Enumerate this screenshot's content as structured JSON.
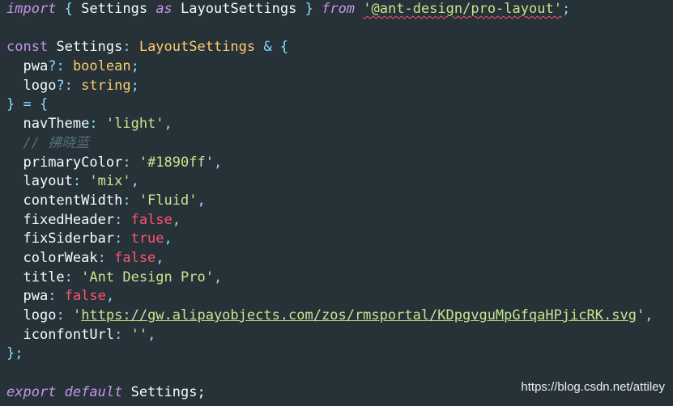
{
  "code": {
    "kw_import": "import",
    "brace_open": "{",
    "brace_close": "}",
    "settings": "Settings",
    "kw_as": "as",
    "layout_settings": "LayoutSettings",
    "kw_from": "from",
    "module_path": "'@ant-design/pro-layout'",
    "semicolon": ";",
    "kw_const": "const",
    "colon": ":",
    "amp": "&",
    "pwa_opt": "pwa",
    "logo_opt": "logo",
    "optional": "?:",
    "type_boolean": "boolean",
    "type_string": "string",
    "type_close_assign": "} = {",
    "comma": ",",
    "props": {
      "navTheme": {
        "key": "navTheme",
        "value": "'light'"
      },
      "comment": "// 拂晓蓝",
      "primaryColor": {
        "key": "primaryColor",
        "value": "'#1890ff'"
      },
      "layout": {
        "key": "layout",
        "value": "'mix'"
      },
      "contentWidth": {
        "key": "contentWidth",
        "value": "'Fluid'"
      },
      "fixedHeader": {
        "key": "fixedHeader",
        "value": "false"
      },
      "fixSiderbar": {
        "key": "fixSiderbar",
        "value": "true"
      },
      "colorWeak": {
        "key": "colorWeak",
        "value": "false"
      },
      "title": {
        "key": "title",
        "value": "'Ant Design Pro'"
      },
      "pwa": {
        "key": "pwa",
        "value": "false"
      },
      "logo": {
        "key": "logo",
        "quote": "'",
        "url": "https://gw.alipayobjects.com/zos/rmsportal/KDpgvguMpGfqaHPjicRK.svg"
      },
      "iconfontUrl": {
        "key": "iconfontUrl",
        "value": "''"
      }
    },
    "end_object": "};",
    "kw_export": "export",
    "kw_default": "default",
    "export_semicolon": ";"
  },
  "watermark": "https://blog.csdn.net/attiley",
  "colors": {
    "background": "#263238",
    "keyword": "#c792ea",
    "punctuation": "#89ddff",
    "type": "#ffcb6b",
    "string": "#c3e88d",
    "boolean": "#ff5370",
    "comment": "#546e7a",
    "text": "#eeffff"
  }
}
